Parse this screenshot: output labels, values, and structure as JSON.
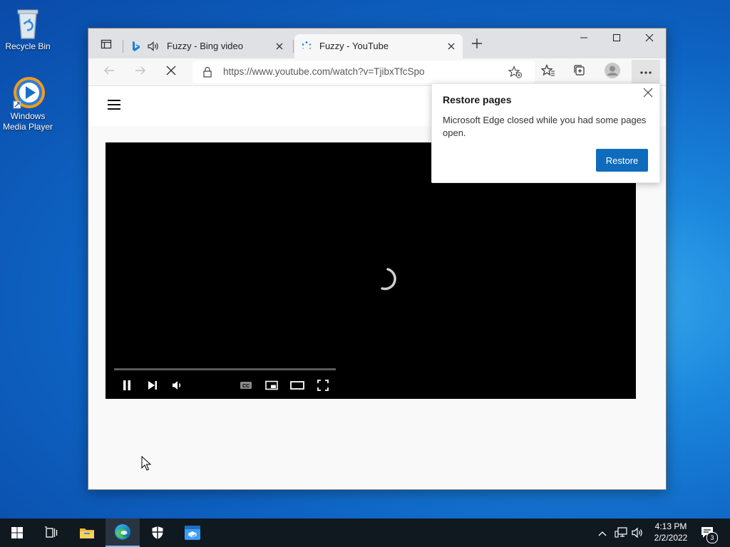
{
  "desktop": {
    "icons": [
      {
        "label": "Recycle Bin"
      },
      {
        "label": "Windows Media Player"
      }
    ]
  },
  "browser": {
    "tabs": [
      {
        "title": "Fuzzy - Bing video"
      },
      {
        "title": "Fuzzy - YouTube"
      }
    ],
    "address": {
      "url": "https://www.youtube.com/watch?v=TjibxTfcSpo"
    }
  },
  "restore_popup": {
    "title": "Restore pages",
    "message": "Microsoft Edge closed while you had some pages open.",
    "button": "Restore"
  },
  "taskbar": {
    "time": "4:13 PM",
    "date": "2/2/2022",
    "notification_count": "3"
  },
  "colors": {
    "accent": "#0f6cbd",
    "taskbar": "#101820"
  }
}
